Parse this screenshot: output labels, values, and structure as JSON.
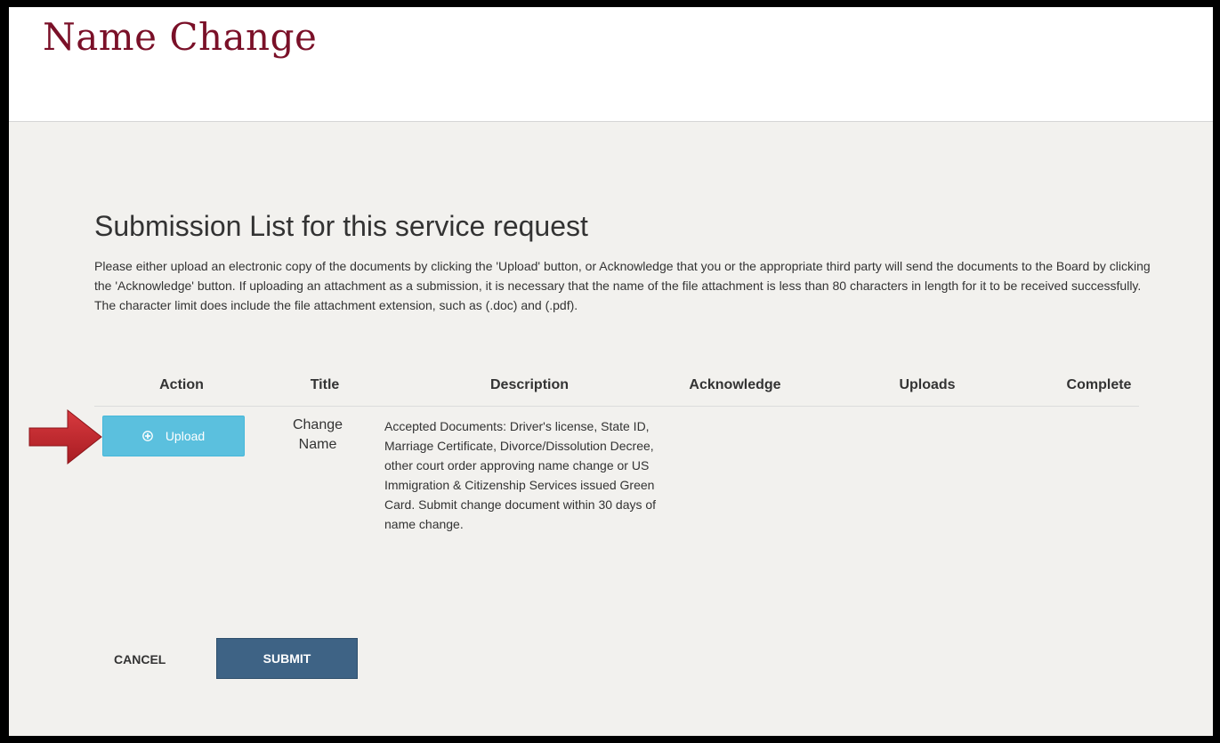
{
  "page": {
    "title": "Name Change"
  },
  "submission": {
    "heading": "Submission List for this service request",
    "instructions": "Please either upload an electronic copy of the documents by clicking the 'Upload' button, or Acknowledge that you or the appropriate third party will send the documents to the Board by clicking the 'Acknowledge' button. If uploading an attachment as a submission, it is necessary that the name of the file attachment is less than 80 characters in length for it to be received successfully. The character limit does include the file attachment extension, such as (.doc) and (.pdf)."
  },
  "table": {
    "columns": [
      "Action",
      "Title",
      "Description",
      "Acknowledge",
      "Uploads",
      "Complete"
    ],
    "rows": [
      {
        "action_label": "Upload",
        "title": "Change Name",
        "description": "Accepted Documents: Driver's license, State ID, Marriage Certificate, Divorce/Dissolution Decree, other court order approving name change or US Immigration & Citizenship Services issued Green Card. Submit change document within 30 days of name change.",
        "acknowledge": "",
        "uploads": "",
        "complete": ""
      }
    ]
  },
  "footer": {
    "cancel_label": "CANCEL",
    "submit_label": "SUBMIT"
  },
  "colors": {
    "title": "#7a1028",
    "upload_button": "#5bc0de",
    "submit_button": "#3e6385",
    "annotation_arrow": "#c0262c",
    "background": "#f2f1ee"
  },
  "icons": {
    "upload": "plus-circle-icon",
    "annotation": "red-arrow-icon"
  }
}
